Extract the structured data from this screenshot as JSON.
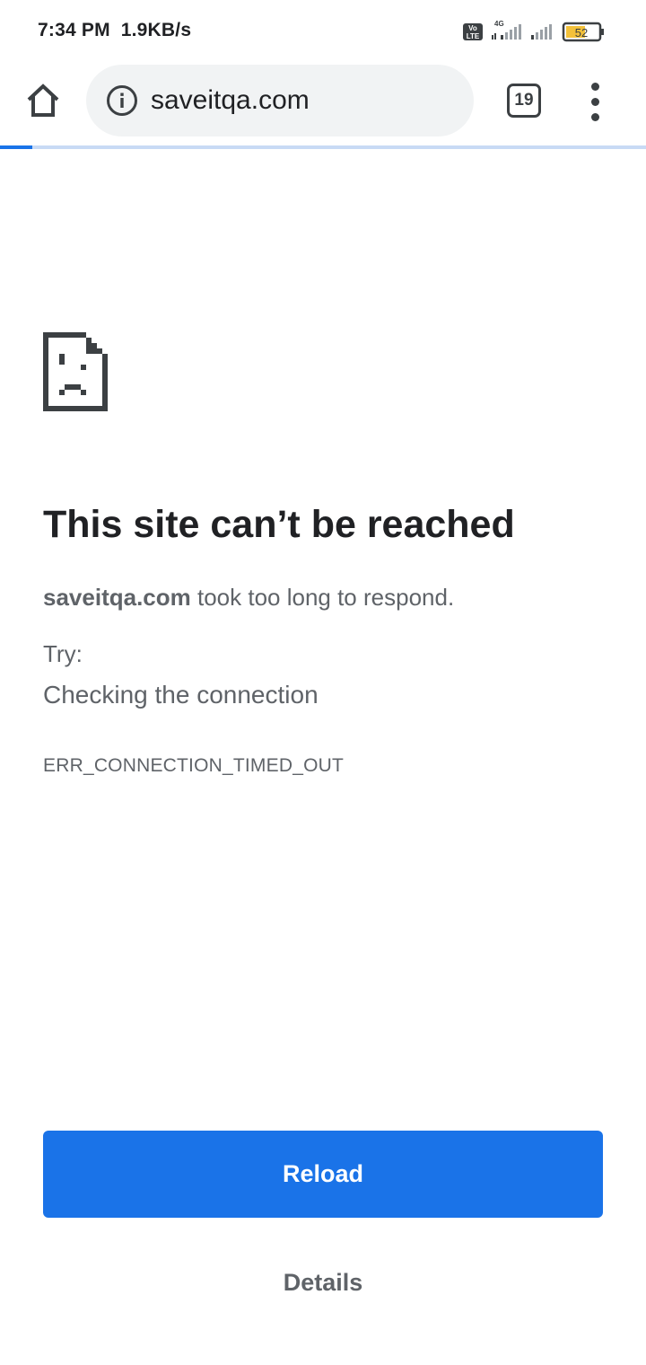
{
  "status_bar": {
    "time": "7:34 PM",
    "net_speed": "1.9KB/s",
    "volte_label": "Vo LTE",
    "network_type": "4G",
    "battery_level": "52"
  },
  "toolbar": {
    "url": "saveitqa.com",
    "tab_count": "19"
  },
  "page_load_progress": 0.05,
  "error_page": {
    "title": "This site can’t be reached",
    "host": "saveitqa.com",
    "message_suffix": " took too long to respond.",
    "try_label": "Try:",
    "suggestion": "Checking the connection",
    "error_code": "ERR_CONNECTION_TIMED_OUT",
    "reload_label": "Reload",
    "details_label": "Details"
  },
  "colors": {
    "accent": "#1a73e8",
    "text_primary": "#202124",
    "text_secondary": "#5f6368",
    "omnibox_bg": "#f1f3f4",
    "battery_fill": "#f3c13a"
  }
}
